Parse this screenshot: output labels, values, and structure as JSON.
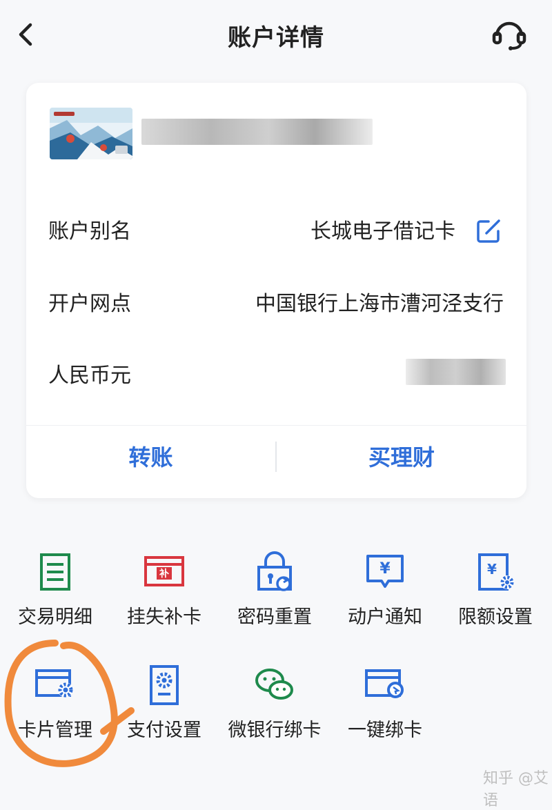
{
  "header": {
    "title": "账户详情"
  },
  "account": {
    "rows": [
      {
        "label": "账户别名",
        "value": "长城电子借记卡"
      },
      {
        "label": "开户网点",
        "value": "中国银行上海市漕河泾支行"
      },
      {
        "label": "人民币元",
        "value": ""
      }
    ],
    "actions": {
      "transfer": "转账",
      "wealth": "买理财"
    }
  },
  "services": [
    {
      "label": "交易明细",
      "icon": "transaction-details-icon",
      "color": "#1e8a4c"
    },
    {
      "label": "挂失补卡",
      "icon": "report-loss-icon",
      "color": "#d9363e"
    },
    {
      "label": "密码重置",
      "icon": "password-reset-icon",
      "color": "#2f6ed9"
    },
    {
      "label": "动户通知",
      "icon": "account-notice-icon",
      "color": "#2f6ed9"
    },
    {
      "label": "限额设置",
      "icon": "limit-settings-icon",
      "color": "#2f6ed9"
    },
    {
      "label": "卡片管理",
      "icon": "card-management-icon",
      "color": "#2f6ed9"
    },
    {
      "label": "支付设置",
      "icon": "payment-settings-icon",
      "color": "#2f6ed9"
    },
    {
      "label": "微银行绑卡",
      "icon": "wechat-bind-icon",
      "color": "#1e8a4c"
    },
    {
      "label": "一键绑卡",
      "icon": "one-click-bind-icon",
      "color": "#2f6ed9"
    }
  ],
  "card_icon_badge": "补",
  "watermark": "知乎 @艾语",
  "colors": {
    "accent": "#2f6ed9",
    "green": "#1e8a4c",
    "red": "#d9363e",
    "highlight": "#f08a3c"
  }
}
